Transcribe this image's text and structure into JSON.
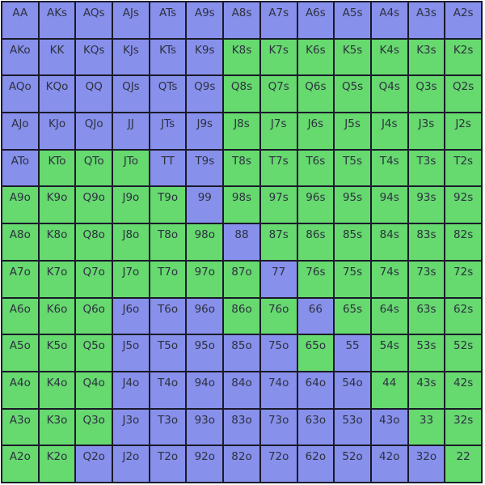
{
  "colors": {
    "raise": "#8790eb",
    "other": "#66d96f"
  },
  "legend_codes": {
    "b": "raise",
    "g": "other"
  },
  "grid": [
    [
      "AA b",
      "AKs b",
      "AQs b",
      "AJs b",
      "ATs b",
      "A9s b",
      "A8s b",
      "A7s b",
      "A6s b",
      "A5s b",
      "A4s b",
      "A3s b",
      "A2s b"
    ],
    [
      "AKo b",
      "KK b",
      "KQs b",
      "KJs b",
      "KTs b",
      "K9s b",
      "K8s g",
      "K7s g",
      "K6s g",
      "K5s g",
      "K4s g",
      "K3s g",
      "K2s g"
    ],
    [
      "AQo b",
      "KQo b",
      "QQ b",
      "QJs b",
      "QTs b",
      "Q9s b",
      "Q8s g",
      "Q7s g",
      "Q6s g",
      "Q5s g",
      "Q4s g",
      "Q3s g",
      "Q2s g"
    ],
    [
      "AJo b",
      "KJo b",
      "QJo b",
      "JJ b",
      "JTs b",
      "J9s b",
      "J8s g",
      "J7s g",
      "J6s g",
      "J5s g",
      "J4s g",
      "J3s g",
      "J2s g"
    ],
    [
      "ATo b",
      "KTo g",
      "QTo g",
      "JTo g",
      "TT b",
      "T9s b",
      "T8s g",
      "T7s g",
      "T6s g",
      "T5s g",
      "T4s g",
      "T3s g",
      "T2s g"
    ],
    [
      "A9o g",
      "K9o g",
      "Q9o g",
      "J9o g",
      "T9o g",
      "99 b",
      "98s g",
      "97s g",
      "96s g",
      "95s g",
      "94s g",
      "93s g",
      "92s g"
    ],
    [
      "A8o g",
      "K8o g",
      "Q8o g",
      "J8o g",
      "T8o g",
      "98o g",
      "88 b",
      "87s g",
      "86s g",
      "85s g",
      "84s g",
      "83s g",
      "82s g"
    ],
    [
      "A7o g",
      "K7o g",
      "Q7o g",
      "J7o g",
      "T7o g",
      "97o g",
      "87o g",
      "77 b",
      "76s g",
      "75s g",
      "74s g",
      "73s g",
      "72s g"
    ],
    [
      "A6o g",
      "K6o g",
      "Q6o g",
      "J6o b",
      "T6o b",
      "96o b",
      "86o g",
      "76o g",
      "66 b",
      "65s g",
      "64s g",
      "63s g",
      "62s g"
    ],
    [
      "A5o g",
      "K5o g",
      "Q5o g",
      "J5o b",
      "T5o b",
      "95o b",
      "85o b",
      "75o b",
      "65o g",
      "55 b",
      "54s g",
      "53s g",
      "52s g"
    ],
    [
      "A4o g",
      "K4o g",
      "Q4o g",
      "J4o b",
      "T4o b",
      "94o b",
      "84o b",
      "74o b",
      "64o b",
      "54o b",
      "44 g",
      "43s g",
      "42s g"
    ],
    [
      "A3o g",
      "K3o g",
      "Q3o g",
      "J3o b",
      "T3o b",
      "93o b",
      "83o b",
      "73o b",
      "63o b",
      "53o b",
      "43o b",
      "33 g",
      "32s g"
    ],
    [
      "A2o g",
      "K2o g",
      "Q2o b",
      "J2o b",
      "T2o b",
      "92o b",
      "82o b",
      "72o b",
      "62o b",
      "52o b",
      "42o b",
      "32o b",
      "22 g"
    ]
  ]
}
